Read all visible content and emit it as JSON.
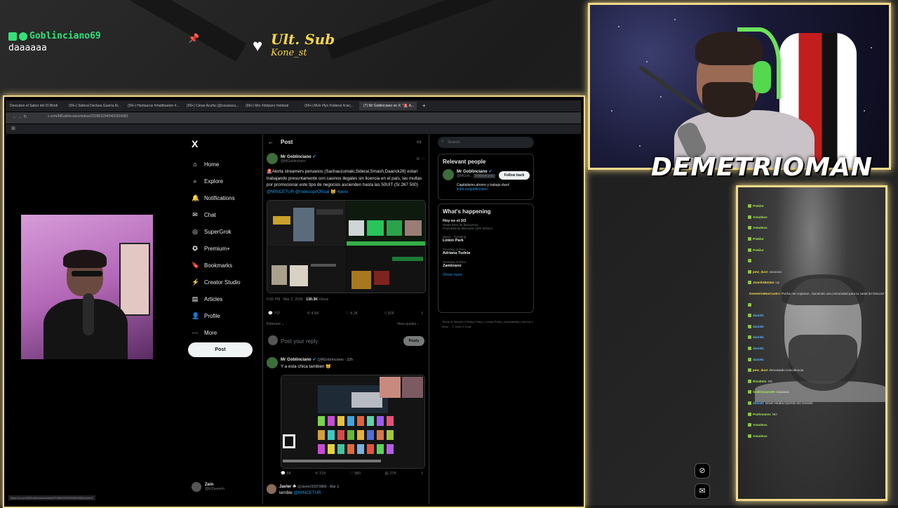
{
  "overlay": {
    "chat_alert_user": "Goblinciano69",
    "chat_alert_msg": "daaaaaa",
    "sub_label": "Ult. Sub",
    "sub_user": "Kone_st",
    "brand": "DEMETRIOMAN"
  },
  "browser": {
    "tabs": [
      "Descubre el Sabor del Di Bindi",
      "(99+) Sideral Declara Guerra Al...",
      "(99+) Hantaurus #mattbeelon #...",
      "(99+) César Acuña (@cesaracu...",
      "(99+) Mrs #dolparo #sideral",
      "(99+) Mick #fys #sideral #cisc...",
      "(7) Mr Goblinciano on X: \"🚨 A..."
    ],
    "address": "x.com/MGoblinciano/status/2028632940402654983",
    "status_url": "https://x.com/MGoblinciano/status/2028632940402654983/photo/1"
  },
  "xnav": {
    "logo": "X",
    "items": [
      {
        "label": "Home",
        "icon": "home-icon",
        "glyph": "⌂"
      },
      {
        "label": "Explore",
        "icon": "search-icon",
        "glyph": "⌕"
      },
      {
        "label": "Notifications",
        "icon": "bell-icon",
        "glyph": "🔔"
      },
      {
        "label": "Chat",
        "icon": "mail-icon",
        "glyph": "✉"
      },
      {
        "label": "SuperGrok",
        "icon": "grok-icon",
        "glyph": "◎"
      },
      {
        "label": "Premium+",
        "icon": "premium-icon",
        "glyph": "✪"
      },
      {
        "label": "Bookmarks",
        "icon": "bookmark-icon",
        "glyph": "🔖"
      },
      {
        "label": "Creator Studio",
        "icon": "creator-studio-icon",
        "glyph": "⚡"
      },
      {
        "label": "Articles",
        "icon": "articles-icon",
        "glyph": "▤"
      },
      {
        "label": "Profile",
        "icon": "profile-icon",
        "glyph": "👤"
      },
      {
        "label": "More",
        "icon": "more-icon",
        "glyph": "⋯"
      }
    ],
    "post_button": "Post",
    "account_name": "Zein",
    "account_handle": "@ElZeeeeIn"
  },
  "post": {
    "header": "Post",
    "author": "Mr Goblinciano",
    "handle": "@MGoblinciano",
    "text": "🚨Alerta streamers peruanos (Sachauzumaki,Sideral,Smash,Daarick28) estan trabajando presuntamente con casinos ilegales sin licencia en el país, las multas por promocionar este tipo de negocios ascienden hasta las 50UIT (S/.267 500)",
    "mentions": "@MINCETUR @Indecopi/Oficial 😺 #peru",
    "time": "6:55 PM · Mar 2, 2026 ·",
    "views": "130.3K",
    "views_label": "Views",
    "counts": {
      "replies": "707",
      "reposts": "4.5K",
      "likes": "4.2K",
      "bookmarks": "326"
    },
    "relevant": "Relevant ⌄",
    "view_quotes": "View quotes ›",
    "reply_placeholder": "Post your reply",
    "reply_button": "Reply"
  },
  "reply1": {
    "author": "Mr Goblinciano",
    "handle": "@MGoblinciano · 22h",
    "text": "Y a esta chica tambien 😺",
    "counts": {
      "replies": "58",
      "reposts": "218",
      "likes": "980",
      "views": "27K"
    }
  },
  "reply2": {
    "author": "Javier ☘",
    "handle": "@Javier33373866 · Mar 2",
    "text": "terrible",
    "mention": "@MINCETUR"
  },
  "sidebar": {
    "search_placeholder": "Search",
    "relevant_title": "Relevant people",
    "person_name": "Mr Goblinciano",
    "person_handle": "@MGob...",
    "person_follows": "Follows you",
    "follow_back": "Follow back",
    "person_bio": "Capitalismo,ahorro y trabajo duro!",
    "person_link": "linktr.ee/goblinciano",
    "happening_title": "What's happening",
    "trends": [
      {
        "cat": "",
        "title": "Hoy es el 3/3",
        "sub": "Hasta 50% de descuento.",
        "sub2": "Promoted by Mercado Libre México"
      },
      {
        "cat": "Music · Trending",
        "title": "Linkin Park",
        "sub": "",
        "sub2": ""
      },
      {
        "cat": "Trending in Peru",
        "title": "Adriana Tudela",
        "sub": "",
        "sub2": ""
      },
      {
        "cat": "Trending in Peru",
        "title": "Zambrano",
        "sub": "",
        "sub2": ""
      }
    ],
    "show_more": "Show more",
    "footer": "Terms of Service | Privacy Policy | Cookie Policy | Accessibility | Ads info | More ... © 2026 X Corp."
  },
  "chat": {
    "lines": [
      {
        "u": "Preklor",
        "m": "",
        "c": "u"
      },
      {
        "u": "Amadeus",
        "m": "",
        "c": "u"
      },
      {
        "u": "Amadeus",
        "m": "",
        "c": "u"
      },
      {
        "u": "Preklor",
        "m": "",
        "c": "u"
      },
      {
        "u": "Preklor",
        "m": "",
        "c": "u"
      },
      {
        "u": "",
        "m": "",
        "c": "u2"
      },
      {
        "u": "pew_dust",
        "m": "ooooooo",
        "c": "u2"
      },
      {
        "u": "JuanitoBatata",
        "m": "Uy",
        "c": "u2"
      },
      {
        "u": "DemetrioMonCastro",
        "m": "Pucha me copiaron...haciendo una comunidad para tu canal de Discord \"Clips\"",
        "c": "u2"
      },
      {
        "u": "",
        "m": "",
        "c": "u"
      },
      {
        "u": "daniel1",
        "m": "",
        "c": "u3"
      },
      {
        "u": "daniel1",
        "m": "",
        "c": "u3"
      },
      {
        "u": "daniel1",
        "m": "",
        "c": "u3"
      },
      {
        "u": "daniel1",
        "m": "",
        "c": "u3"
      },
      {
        "u": "daniel1",
        "m": "",
        "c": "u3"
      },
      {
        "u": "pew_dust",
        "m": "demasiado coincidencia",
        "c": "u2"
      },
      {
        "u": "Ricabeto",
        "m": "XD",
        "c": "u"
      },
      {
        "u": "Goblinciano69",
        "m": "daaaaaa",
        "c": "u"
      },
      {
        "u": "daniel1",
        "m": "Israel estaba leyendo los reviews",
        "c": "u3"
      },
      {
        "u": "Pushmanss",
        "m": "NO",
        "c": "u"
      },
      {
        "u": "Amadeus",
        "m": "",
        "c": "u"
      },
      {
        "u": "Amadeus",
        "m": "",
        "c": "u"
      }
    ]
  }
}
